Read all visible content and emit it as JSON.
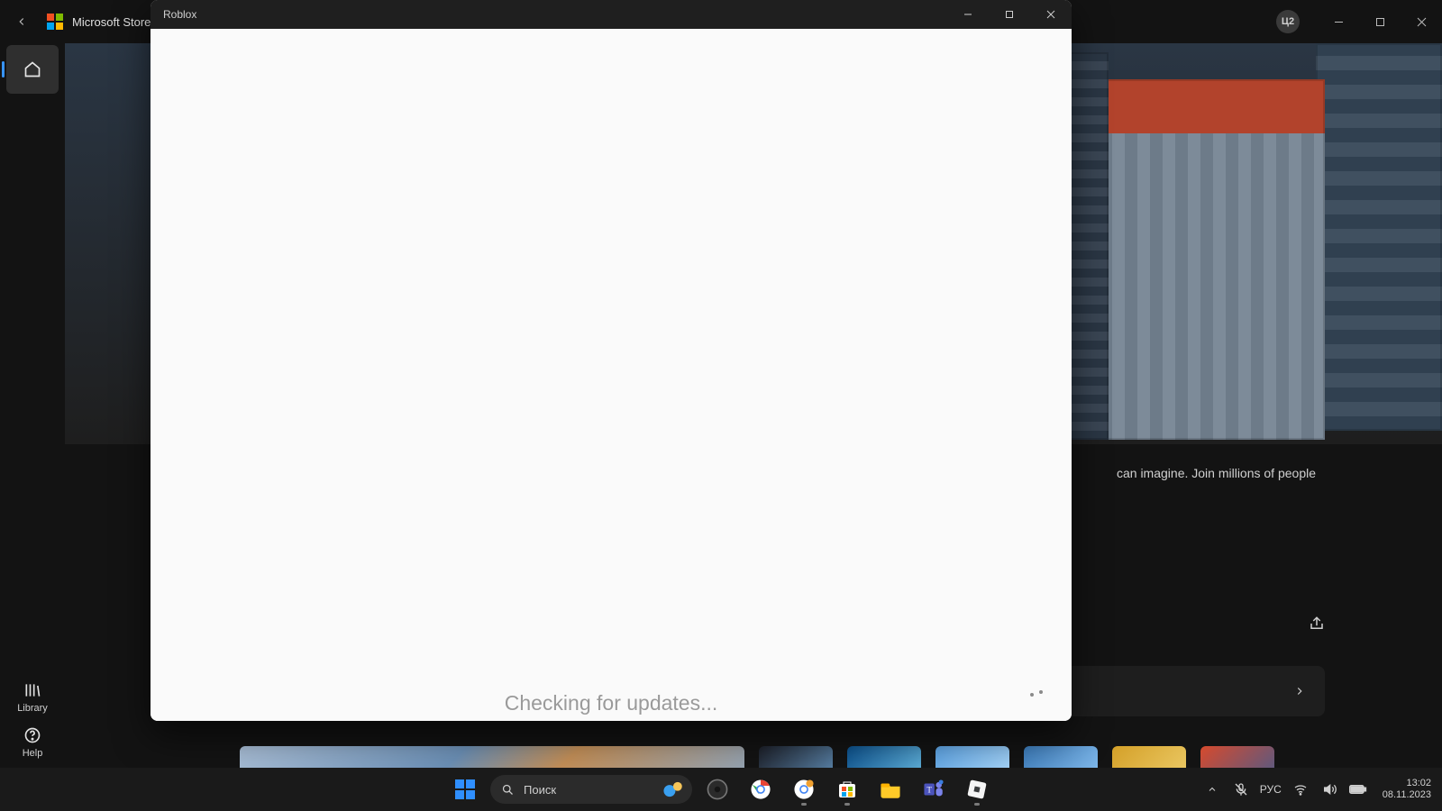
{
  "store": {
    "title": "Microsoft Store",
    "user_initials": "Ц2",
    "rail": {
      "library_label": "Library",
      "help_label": "Help"
    },
    "description_fragment": "can imagine. Join millions of people"
  },
  "roblox": {
    "title": "Roblox",
    "status": "Checking for updates..."
  },
  "taskbar": {
    "search_placeholder": "Поиск",
    "lang": "РУС",
    "time": "13:02",
    "date": "08.11.2023"
  }
}
